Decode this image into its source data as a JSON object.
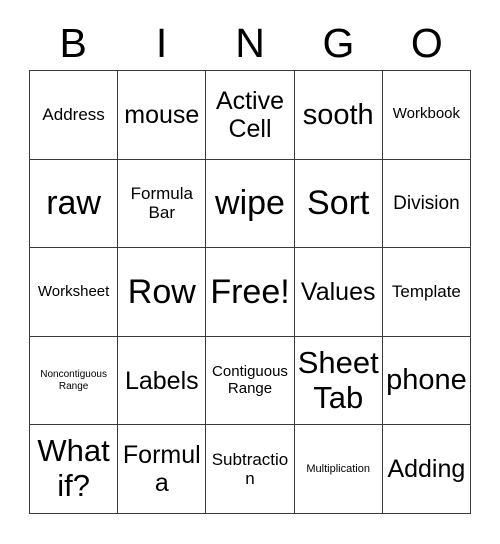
{
  "card": {
    "type": "bingo-card",
    "title_letters": [
      "B",
      "I",
      "N",
      "G",
      "O"
    ],
    "columns": 5,
    "rows": 5,
    "free_space_label": "Free!",
    "free_space_position": "row3-col3",
    "colors": {
      "background": "#ffffff",
      "text": "#000000",
      "border": "#3a3a3a"
    },
    "cells": [
      {
        "text": "Address",
        "size": "fs-lg"
      },
      {
        "text": "mouse",
        "size": "fs-3xl"
      },
      {
        "text": "Active Cell",
        "size": "fs-3xl"
      },
      {
        "text": "sooth",
        "size": "fs-4xl"
      },
      {
        "text": "Workbook",
        "size": "fs-md"
      },
      {
        "text": "raw",
        "size": "fs-6xl"
      },
      {
        "text": "Formula Bar",
        "size": "fs-lg"
      },
      {
        "text": "wipe",
        "size": "fs-6xl"
      },
      {
        "text": "Sort",
        "size": "fs-6xl"
      },
      {
        "text": "Division",
        "size": "fs-xl"
      },
      {
        "text": "Worksheet",
        "size": "fs-md"
      },
      {
        "text": "Row",
        "size": "fs-6xl"
      },
      {
        "text": "Free!",
        "size": "fs-6xl"
      },
      {
        "text": "Values",
        "size": "fs-3xl"
      },
      {
        "text": "Template",
        "size": "fs-lg"
      },
      {
        "text": "Noncontiguous Range",
        "size": "fs-xs"
      },
      {
        "text": "Labels",
        "size": "fs-3xl"
      },
      {
        "text": "Contiguous Range",
        "size": "fs-md"
      },
      {
        "text": "Sheet Tab",
        "size": "fs-5xl"
      },
      {
        "text": "phone",
        "size": "fs-4xl"
      },
      {
        "text": "What if?",
        "size": "fs-5xl"
      },
      {
        "text": "Formula",
        "size": "fs-3xl"
      },
      {
        "text": "Subtraction",
        "size": "fs-lg"
      },
      {
        "text": "Multiplication",
        "size": "fs-sm"
      },
      {
        "text": "Adding",
        "size": "fs-3xl"
      }
    ]
  }
}
